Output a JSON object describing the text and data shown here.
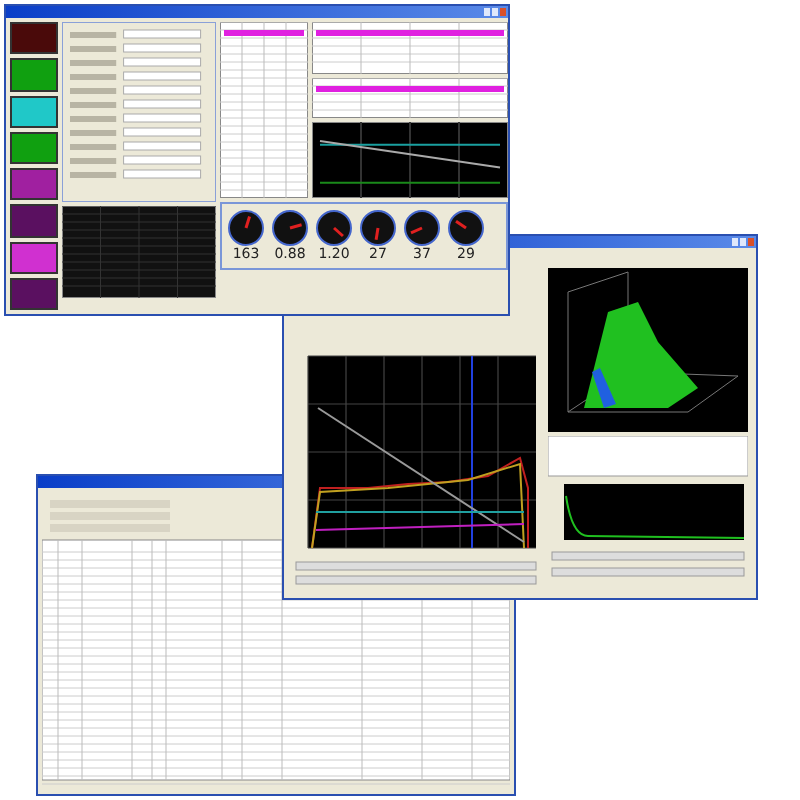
{
  "windows": [
    {
      "kind": "table"
    },
    {
      "kind": "chart"
    },
    {
      "kind": "main"
    }
  ],
  "sidebar_blocks": [
    {
      "color": "#4a0a0a"
    },
    {
      "color": "#10a010"
    },
    {
      "color": "#20c8c8"
    },
    {
      "color": "#10a010"
    },
    {
      "color": "#a020a0"
    },
    {
      "color": "#5a1060"
    },
    {
      "color": "#d030d0"
    },
    {
      "color": "#5a1060"
    }
  ],
  "gauges": [
    {
      "reading": "163"
    },
    {
      "reading": "0.88"
    },
    {
      "reading": "1.20"
    },
    {
      "reading": "27"
    },
    {
      "reading": "37"
    },
    {
      "reading": "29"
    }
  ]
}
